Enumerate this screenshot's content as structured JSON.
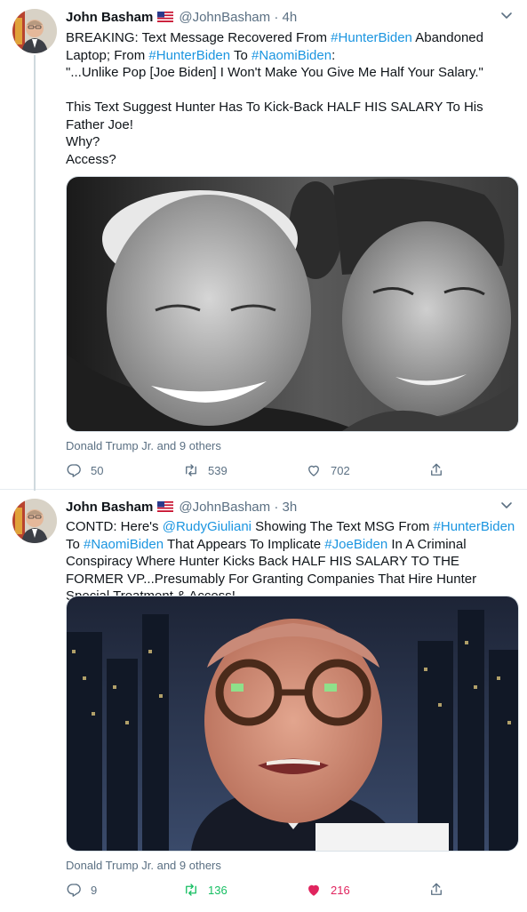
{
  "tweets": [
    {
      "author_name": "John Basham",
      "author_handle": "@JohnBasham",
      "separator": "·",
      "time": "4h",
      "text": {
        "p1_a": "BREAKING: Text Message Recovered From ",
        "tag_hunter": "#HunterBiden",
        "p1_b": " Abandoned Laptop; From ",
        "tag_hunter2": "#HunterBiden",
        "p1_c": " To ",
        "tag_naomi": "#NaomiBiden",
        "p1_d": ":",
        "line2": "\"...Unlike Pop [Joe Biden] I Won't Make You Give Me Half Your Salary.\"",
        "line3": "This Text Suggest Hunter Has To Kick-Back HALF HIS SALARY To His Father Joe!",
        "line4": "Why?",
        "line5": "Access?"
      },
      "social_context": "Donald Trump Jr. and 9 others",
      "replies": "50",
      "retweets": "539",
      "likes": "702",
      "retweeted": false,
      "liked": false
    },
    {
      "author_name": "John Basham",
      "author_handle": "@JohnBasham",
      "separator": "·",
      "time": "3h",
      "text": {
        "a": "CONTD: Here's ",
        "tag_rudy": "@RudyGiuliani",
        "b": " Showing The Text MSG From ",
        "tag_hunter": "#HunterBiden",
        "c": " To ",
        "tag_naomi": "#NaomiBiden",
        "d": " That Appears To Implicate ",
        "tag_joe": "#JoeBiden",
        "e": " In A Criminal Conspiracy Where Hunter Kicks Back HALF HIS SALARY TO THE FORMER VP...Presumably For Granting Companies That Hire Hunter Special Treatment & Access!"
      },
      "social_context": "Donald Trump Jr. and 9 others",
      "replies": "9",
      "retweets": "136",
      "likes": "216",
      "retweeted": true,
      "liked": true
    }
  ],
  "colors": {
    "link": "#1b95e0",
    "muted": "#5b7083",
    "retweet_active": "#17bf63",
    "like_active": "#e0245e"
  },
  "icons": [
    "flag-icon",
    "chevron-down-icon",
    "reply-icon",
    "retweet-icon",
    "like-icon",
    "share-icon"
  ]
}
